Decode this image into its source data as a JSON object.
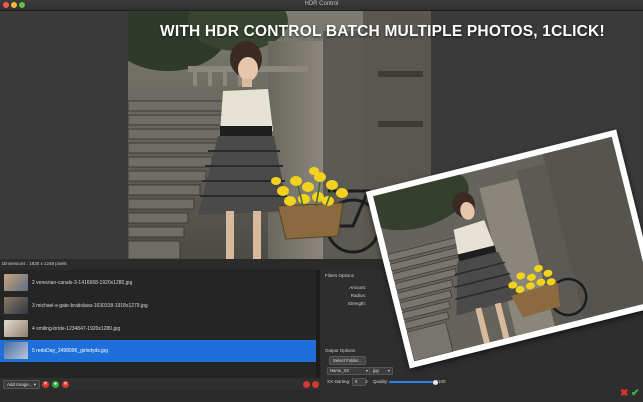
{
  "window": {
    "title": "HDR Control"
  },
  "headline": "WITH HDR CONTROL BATCH MULTIPLE PHOTOS, 1CLICK!",
  "preview": {
    "dimensions_text": "Dimensions : 1920 x 1248 pixels"
  },
  "file_list": {
    "items": [
      {
        "name": "2 venezian-canals-3-1416968-1920x1280.jpg",
        "selected": false
      },
      {
        "name": "3 michael-s-gate-bratislava-1630318-1918x1279.jpg",
        "selected": false
      },
      {
        "name": "4 smiling-bride-1234847-1920x1280.jpg",
        "selected": false
      },
      {
        "name": "5 redoDay_2498996_girlsdyds.jpg",
        "selected": true
      }
    ]
  },
  "bottom_bar": {
    "add_image_label": "Add Image...",
    "remove_label": "✕",
    "move_label": "●",
    "clear_label": "✕"
  },
  "filters": {
    "section_label": "Filters Options",
    "amount_label": "Amount:",
    "radius_label": "Radius:",
    "strength_label": "Strength:"
  },
  "output": {
    "section_label": "Output Options",
    "select_folder_label": "Select Folder...",
    "name_select": "Name_XX",
    "format_select": ".jpg",
    "xx_starting_label": "XX starting:",
    "xx_starting_value": "0",
    "quality_label": "Quality:",
    "quality_value": "100",
    "quality_fraction": 1.0
  },
  "actions": {
    "cancel_icon": "cross-icon",
    "ok_icon": "check-icon"
  },
  "colors": {
    "accent": "#1e6fd9",
    "cancel": "#e0342b",
    "ok": "#2fbf3a"
  }
}
